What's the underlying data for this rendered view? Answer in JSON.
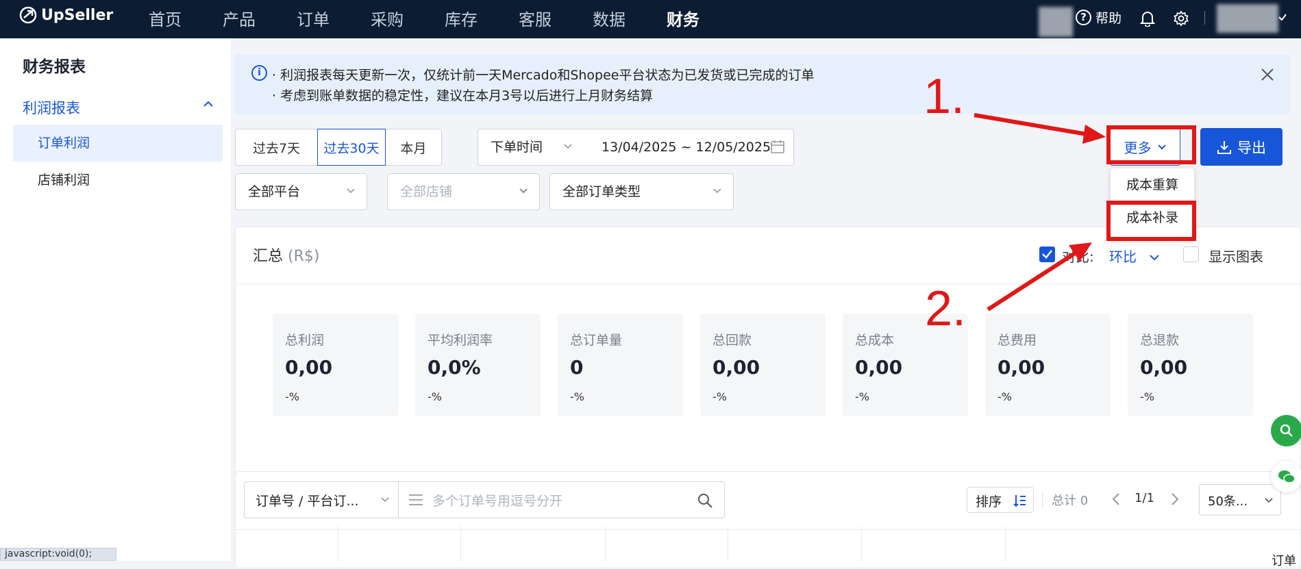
{
  "topbar": {
    "brand": "UpSeller",
    "nav": [
      "首页",
      "产品",
      "订单",
      "采购",
      "库存",
      "客服",
      "数据",
      "财务"
    ],
    "active_nav": "财务",
    "help_label": "帮助"
  },
  "sidebar": {
    "title": "财务报表",
    "group_label": "利润报表",
    "items": [
      "订单利润",
      "店铺利润"
    ],
    "active_item": "订单利润"
  },
  "notice": {
    "line1": "· 利润报表每天更新一次，仅统计前一天Mercado和Shopee平台状态为已发货或已完成的订单",
    "line2": "· 考虑到账单数据的稳定性，建议在本月3号以后进行上月财务结算"
  },
  "filters": {
    "range_buttons": [
      "过去7天",
      "过去30天",
      "本月"
    ],
    "selected_range": "过去30天",
    "time_type": "下单时间",
    "date_start": "13/04/2025",
    "date_sep": "~",
    "date_end": "12/05/2025",
    "platform": "全部平台",
    "store_placeholder": "全部店铺",
    "order_type": "全部订单类型"
  },
  "actions": {
    "more_label": "更多",
    "export_label": "导出",
    "more_menu": [
      "成本重算",
      "成本补录"
    ]
  },
  "summary": {
    "title": "汇总",
    "unit": "(R$)",
    "compare_label": "对比:",
    "compare_value": "环比",
    "compare_checked": true,
    "show_chart_label": "显示图表",
    "show_chart_checked": false,
    "stats": [
      {
        "label": "总利润",
        "value": "0,00",
        "change": "-%"
      },
      {
        "label": "平均利润率",
        "value": "0,0%",
        "change": "-%"
      },
      {
        "label": "总订单量",
        "value": "0",
        "change": "-%"
      },
      {
        "label": "总回款",
        "value": "0,00",
        "change": "-%"
      },
      {
        "label": "总成本",
        "value": "0,00",
        "change": "-%"
      },
      {
        "label": "总费用",
        "value": "0,00",
        "change": "-%"
      },
      {
        "label": "总退款",
        "value": "0,00",
        "change": "-%"
      }
    ]
  },
  "query": {
    "field_select": "订单号 / 平台订...",
    "search_placeholder": "多个订单号用逗号分开",
    "sort_label": "排序",
    "total_label": "总计 0",
    "page": "1/1",
    "page_size": "50条..."
  },
  "table": {
    "partial_header": "订单"
  },
  "annotations": {
    "step1": "1.",
    "step2": "2.",
    "color": "#e01818"
  },
  "status_bar": {
    "url": "javascript:void(0);"
  },
  "colors": {
    "primary": "#1756d8",
    "topbar": "#0b1c33",
    "notice_bg": "#e6f0fd"
  }
}
